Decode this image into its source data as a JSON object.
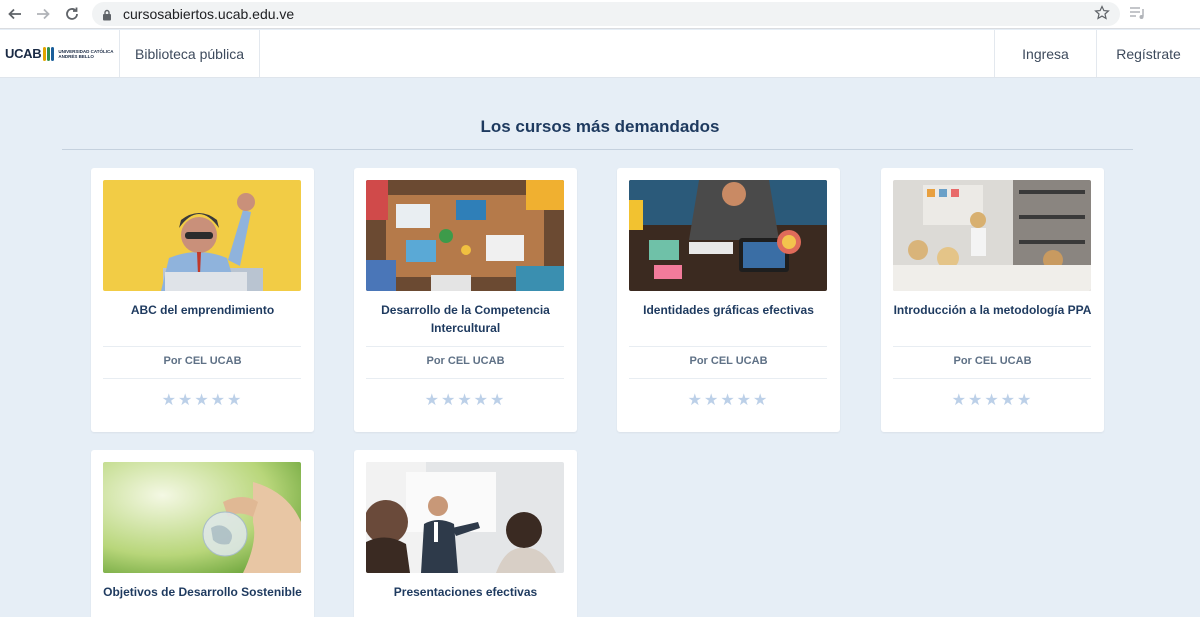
{
  "browser": {
    "url": "cursosabiertos.ucab.edu.ve"
  },
  "header": {
    "logo_text": "UCAB",
    "logo_sub_1": "UNIVERSIDAD CATÓLICA",
    "logo_sub_2": "ANDRÉS BELLO",
    "nav_library": "Biblioteca pública",
    "login": "Ingresa",
    "register": "Regístrate"
  },
  "main": {
    "title": "Los cursos más demandados",
    "courses": [
      {
        "title": "ABC del emprendimiento",
        "author": "Por CEL UCAB",
        "rating": 0,
        "image": "entrepreneur-photo"
      },
      {
        "title": "Desarrollo de la Competencia Intercultural",
        "author": "Por CEL UCAB",
        "rating": 0,
        "image": "team-table-photo"
      },
      {
        "title": "Identidades gráficas efectivas",
        "author": "Por CEL UCAB",
        "rating": 0,
        "image": "designer-desk-photo"
      },
      {
        "title": "Introducción a la metodología PPA",
        "author": "Por CEL UCAB",
        "rating": 0,
        "image": "office-meeting-photo"
      },
      {
        "title": "Objetivos de Desarrollo Sostenible",
        "image": "glass-globe-photo"
      },
      {
        "title": "Presentaciones efectivas",
        "image": "presenter-photo"
      }
    ],
    "stars_glyph": "★★★★★"
  },
  "colors": {
    "page_bg": "#e6eef6",
    "title": "#1e3a5f",
    "star": "#bcd0e8"
  }
}
